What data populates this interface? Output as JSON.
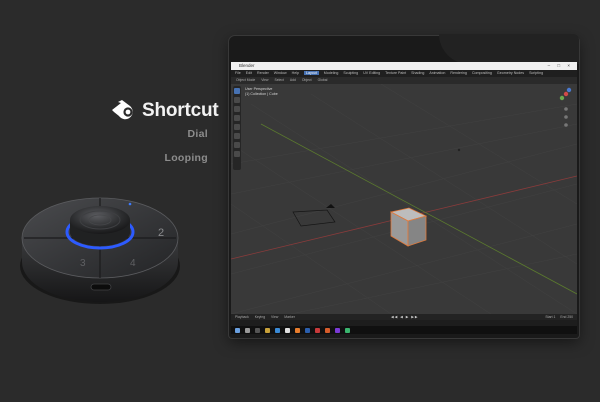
{
  "brand": {
    "name": "Shortcut",
    "logo_icon": "blender-logo-icon"
  },
  "features": [
    "Dial",
    "Looping"
  ],
  "device": {
    "button_labels": [
      "1",
      "2",
      "3",
      "4"
    ],
    "ring_color": "#2d5bff"
  },
  "blender": {
    "window_title": "Blender",
    "window_controls": "– □ ×",
    "menu_items": [
      "File",
      "Edit",
      "Render",
      "Window",
      "Help"
    ],
    "workspace_tabs": [
      "Layout",
      "Modeling",
      "Sculpting",
      "UV Editing",
      "Texture Paint",
      "Shading",
      "Animation",
      "Rendering",
      "Compositing",
      "Geometry Nodes",
      "Scripting"
    ],
    "active_tab": "Layout",
    "header_items": [
      "Object Mode",
      "View",
      "Select",
      "Add",
      "Object",
      "Global"
    ],
    "viewport_info": [
      "User Perspective",
      "(1) Collection | Cube"
    ],
    "timeline_items": [
      "Playback",
      "Keying",
      "View",
      "Marker"
    ],
    "timeline_controls": "◀◀ ◀ ▶ ▶▶",
    "timeline_frames": [
      "Start 1",
      "End 250"
    ],
    "accent_color": "#4772b3",
    "selection_color": "#e2793a"
  }
}
